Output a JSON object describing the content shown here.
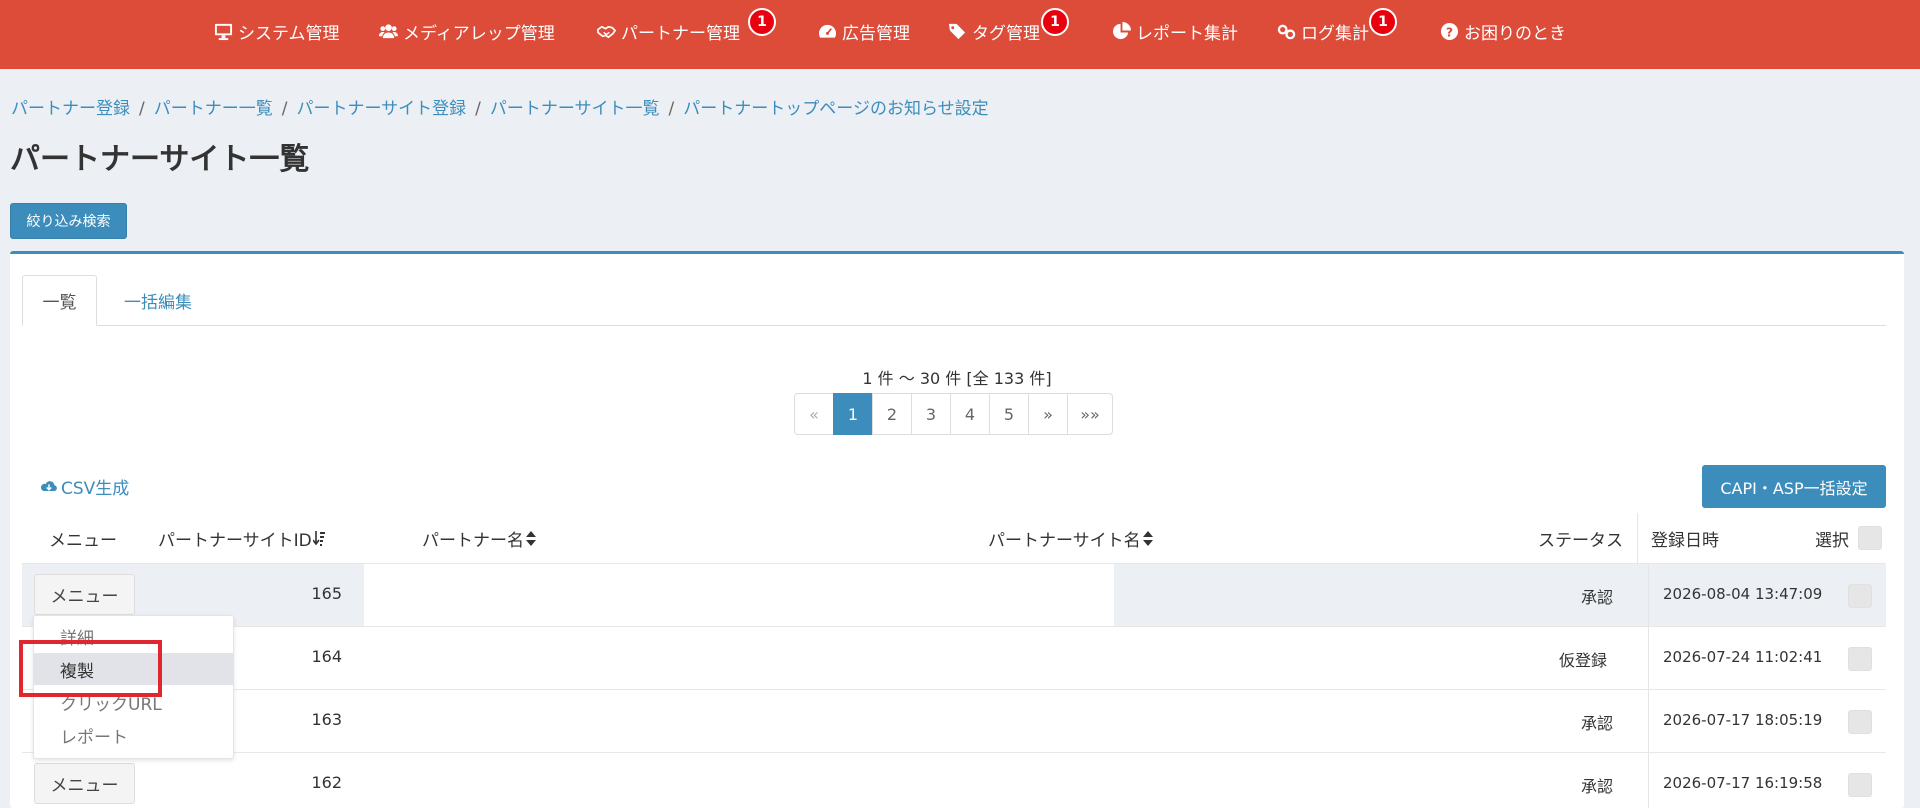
{
  "nav": {
    "items": [
      {
        "label": "システム管理",
        "icon": "monitor-icon"
      },
      {
        "label": "メディアレップ管理",
        "icon": "users-icon"
      },
      {
        "label": "パートナー管理",
        "icon": "handshake-icon",
        "badge": "1"
      },
      {
        "label": "広告管理",
        "icon": "dashboard-icon"
      },
      {
        "label": "タグ管理",
        "icon": "tags-icon",
        "badge": "1"
      },
      {
        "label": "レポート集計",
        "icon": "pie-chart-icon"
      },
      {
        "label": "ログ集計",
        "icon": "link-icon",
        "badge": "1"
      },
      {
        "label": "お困りのとき",
        "icon": "question-circle-icon"
      }
    ]
  },
  "breadcrumb": [
    "パートナー登録",
    "パートナー一覧",
    "パートナーサイト登録",
    "パートナーサイト一覧",
    "パートナートップページのお知らせ設定"
  ],
  "page_title": "パートナーサイト一覧",
  "filter_button": "絞り込み検索",
  "tabs": [
    "一覧",
    "一括編集"
  ],
  "range_text": "1 件 〜 30 件 [全 133 件]",
  "pagination": [
    "«",
    "1",
    "2",
    "3",
    "4",
    "5",
    "»",
    "»»"
  ],
  "csv_label": "CSV生成",
  "capi_button": "CAPI・ASP一括設定",
  "table": {
    "headers": {
      "menu": "メニュー",
      "site_id": "パートナーサイトID",
      "partner_name": "パートナー名",
      "site_name": "パートナーサイト名",
      "status": "ステータス",
      "registered": "登録日時",
      "select": "選択"
    },
    "rows": [
      {
        "id": "165",
        "status": "承認",
        "date": "2026-08-04 13:47:09",
        "menu": "メニュー"
      },
      {
        "id": "164",
        "status": "仮登録",
        "date": "2026-07-24 11:02:41",
        "menu": ""
      },
      {
        "id": "163",
        "status": "承認",
        "date": "2026-07-17 18:05:19",
        "menu": ""
      },
      {
        "id": "162",
        "status": "承認",
        "date": "2026-07-17 16:19:58",
        "menu": "メニュー"
      }
    ]
  },
  "dropdown": [
    "詳細",
    "複製",
    "クリックURL",
    "レポート"
  ],
  "colors": {
    "nav": "#dd4b39",
    "primary": "#3c8dbc",
    "highlight": "#e0272f",
    "badge": "#e8000f"
  }
}
